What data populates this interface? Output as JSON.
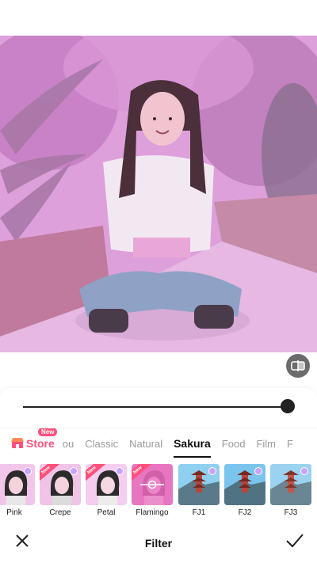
{
  "slider": {
    "value": 1.0
  },
  "store": {
    "label": "Store",
    "badge": "New"
  },
  "tabs": [
    {
      "label": "ou"
    },
    {
      "label": "Classic"
    },
    {
      "label": "Natural"
    },
    {
      "label": "Sakura",
      "active": true
    },
    {
      "label": "Food"
    },
    {
      "label": "Film"
    },
    {
      "label": "F"
    }
  ],
  "filters": [
    {
      "label": "Pink",
      "new": false
    },
    {
      "label": "Crepe",
      "new": true
    },
    {
      "label": "Petal",
      "new": true
    },
    {
      "label": "Flamingo",
      "new": true
    },
    {
      "label": "FJ1",
      "new": false
    },
    {
      "label": "FJ2",
      "new": false
    },
    {
      "label": "FJ3",
      "new": false
    }
  ],
  "bottom_bar": {
    "title": "Filter"
  },
  "colors": {
    "accent": "#ff4f7a",
    "tint": "#e3a6df",
    "dark": "#222222"
  }
}
